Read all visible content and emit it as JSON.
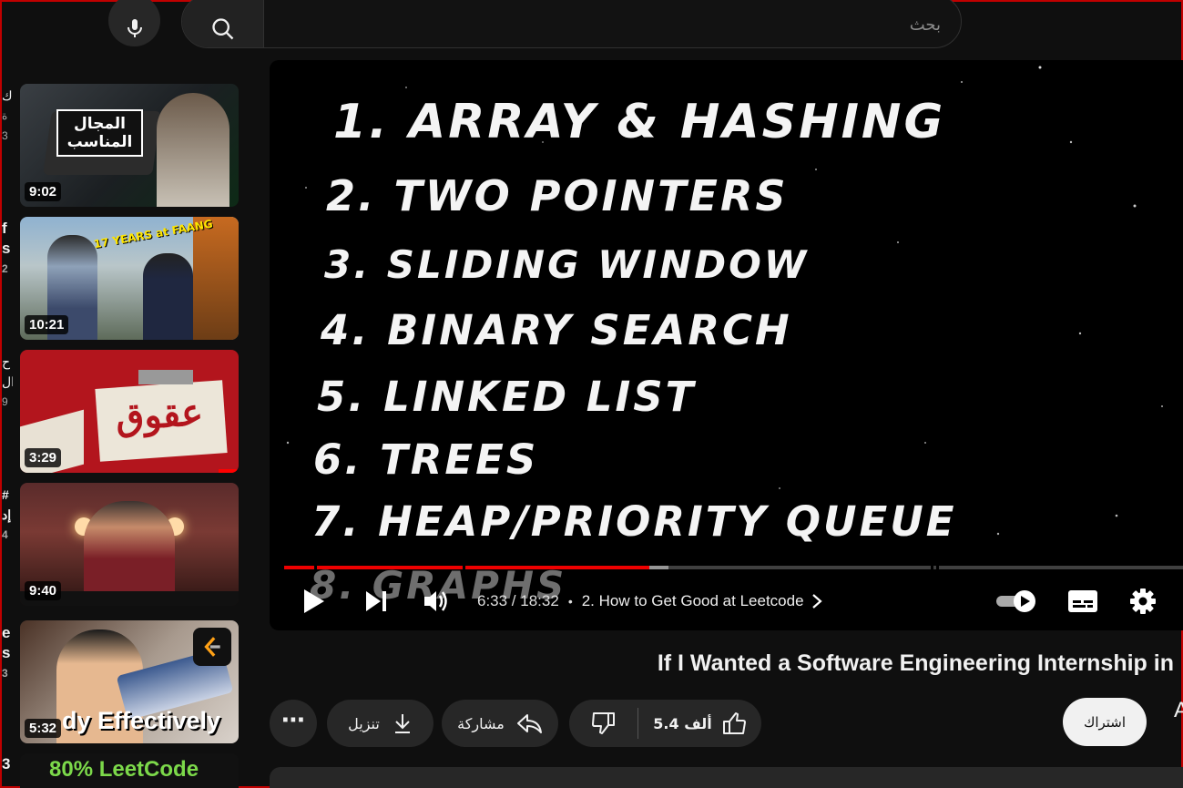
{
  "search": {
    "placeholder": "بحث"
  },
  "icons": {
    "mic": "microphone-icon",
    "search": "search-icon"
  },
  "recommendations": [
    {
      "duration": "9:02",
      "caption": "المجال المناسب",
      "edge_title": "ك",
      "edge_sub": "ة",
      "edge_meta": "3"
    },
    {
      "duration": "10:21",
      "caption": "17 YEARS at FAANG",
      "edge_title": "f",
      "edge_sub": "s",
      "edge_meta": "2"
    },
    {
      "duration": "3:29",
      "caption": "عقوق",
      "edge_title": "ح",
      "edge_sub": "ال",
      "edge_meta": "9"
    },
    {
      "duration": "9:40",
      "caption": "",
      "edge_title": "#",
      "edge_sub": "إد",
      "edge_meta": "4"
    },
    {
      "duration": "5:32",
      "caption": "dy Effectively",
      "edge_title": "e",
      "edge_sub": "s",
      "edge_meta": "3"
    },
    {
      "duration": "",
      "caption": "80% LeetCode",
      "edge_title": "3",
      "edge_sub": "",
      "edge_meta": ""
    }
  ],
  "player": {
    "topics": [
      "1. ARRAY & HASHING",
      "2. TWO POINTERS",
      "3. SLIDING WINDOW",
      "4. BINARY SEARCH",
      "5. LINKED LIST",
      "6. TREES",
      "7. HEAP/PRIORITY QUEUE",
      "8. GRAPHS"
    ],
    "time": "6:33 / 18:32",
    "separator": "•",
    "chapter": "2. How to Get Good at Leetcode",
    "progress_played": 0.405,
    "progress_buffered": 0.427
  },
  "video": {
    "title": "If I Wanted a Software Engineering Internship in"
  },
  "actions": {
    "more": "⋯",
    "download": "تنزيل",
    "share": "مشاركة",
    "like_count": "5.4 ألف",
    "subscribe": "اشتراك",
    "edge_letter": "A"
  },
  "colors": {
    "accent": "#ff0000",
    "background": "#0f0f0f",
    "pill": "#272727"
  }
}
